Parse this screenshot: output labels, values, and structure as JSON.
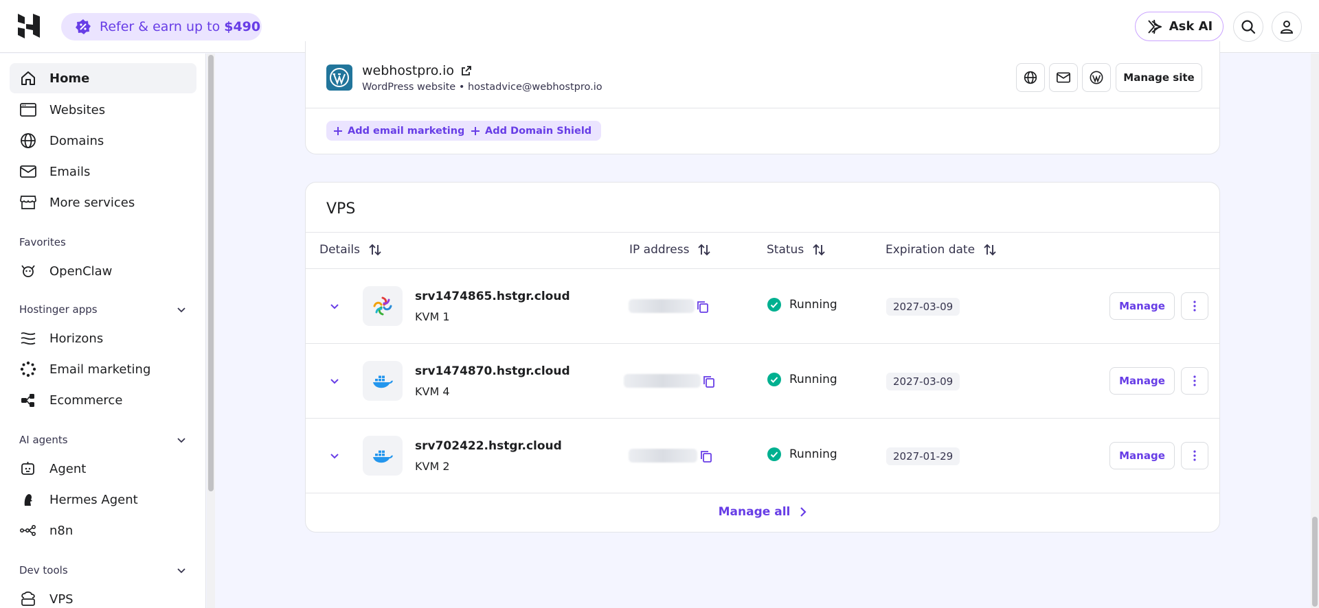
{
  "topbar": {
    "refer_text": "Refer & earn up to",
    "refer_amount": "$490",
    "ask_ai": "Ask AI"
  },
  "sidebar": {
    "items": [
      {
        "label": "Home",
        "icon": "home-icon"
      },
      {
        "label": "Websites",
        "icon": "browser-icon"
      },
      {
        "label": "Domains",
        "icon": "globe-icon"
      },
      {
        "label": "Emails",
        "icon": "mail-icon"
      },
      {
        "label": "More services",
        "icon": "store-icon"
      }
    ],
    "favorites_label": "Favorites",
    "favorites": [
      {
        "label": "OpenClaw",
        "icon": "openclaw-icon"
      }
    ],
    "apps_label": "Hostinger apps",
    "apps": [
      {
        "label": "Horizons",
        "icon": "horizons-icon"
      },
      {
        "label": "Email marketing",
        "icon": "email-marketing-icon"
      },
      {
        "label": "Ecommerce",
        "icon": "ecommerce-icon"
      }
    ],
    "agents_label": "AI agents",
    "agents": [
      {
        "label": "Agent",
        "icon": "agent-icon"
      },
      {
        "label": "Hermes Agent",
        "icon": "hermes-icon"
      },
      {
        "label": "n8n",
        "icon": "n8n-icon"
      }
    ],
    "devtools_label": "Dev tools",
    "devtools": [
      {
        "label": "VPS",
        "icon": "vps-icon"
      }
    ]
  },
  "site": {
    "name": "webhostpro.io",
    "subtitle": "WordPress website • hostadvice@webhostpro.io",
    "manage_label": "Manage site",
    "add_email_marketing": "Add email marketing",
    "add_domain_shield": "Add Domain Shield"
  },
  "vps": {
    "title": "VPS",
    "headers": {
      "details": "Details",
      "ip": "IP address",
      "status": "Status",
      "expiration": "Expiration date"
    },
    "rows": [
      {
        "host": "srv1474865.hstgr.cloud",
        "plan": "KVM 1",
        "status": "Running",
        "expires": "2027-03-09",
        "os_icon": "openclaw-app-icon"
      },
      {
        "host": "srv1474870.hstgr.cloud",
        "plan": "KVM 4",
        "status": "Running",
        "expires": "2027-03-09",
        "os_icon": "docker-icon"
      },
      {
        "host": "srv702422.hstgr.cloud",
        "plan": "KVM 2",
        "status": "Running",
        "expires": "2027-01-29",
        "os_icon": "docker-icon"
      }
    ],
    "manage_label": "Manage",
    "manage_all": "Manage all"
  },
  "colors": {
    "accent": "#673de6",
    "accent_bg": "#ebe4ff",
    "success": "#00b090"
  }
}
